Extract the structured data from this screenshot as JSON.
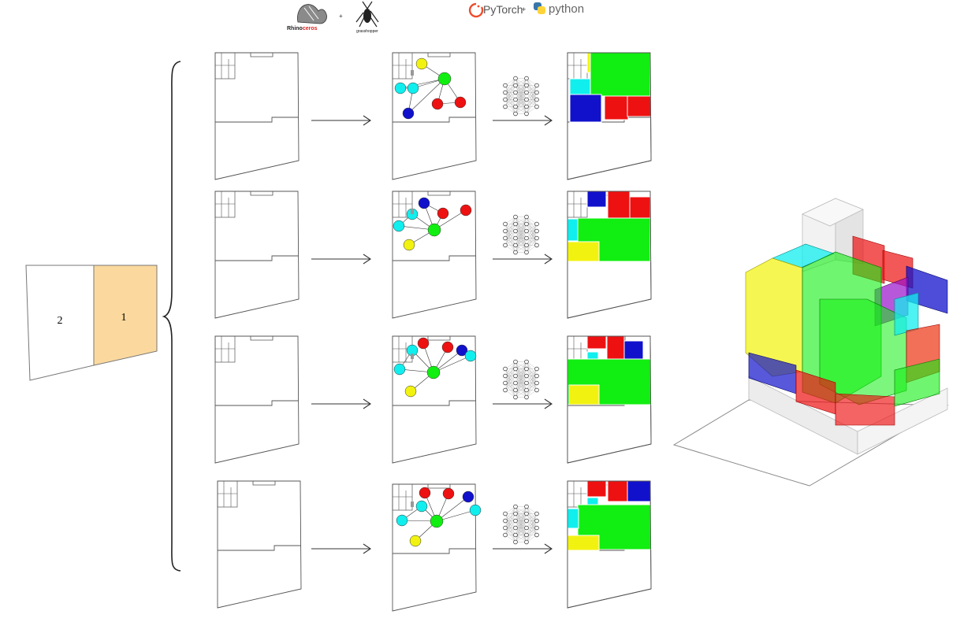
{
  "header": {
    "rhino_logo": {
      "icon": "rhino-icon",
      "prefix": "Rhino",
      "suffix": "ceros"
    },
    "plus_1": "+",
    "grasshopper_logo": {
      "icon": "grasshopper-icon",
      "label": "grasshopper"
    },
    "pytorch_logo": {
      "icon": "pytorch-icon",
      "label": "PyTorch"
    },
    "plus_2": "+",
    "python_logo": {
      "icon": "python-icon",
      "label": "python"
    }
  },
  "site_plan": {
    "plots": [
      {
        "label": "2",
        "color": "#ffffff"
      },
      {
        "label": "1",
        "color": "#fbd99e"
      }
    ]
  },
  "rows_count": 4,
  "colors": {
    "living": "#11ee11",
    "bedroom": "#ee1111",
    "bath": "#1111cc",
    "service": "#11eeee",
    "entry": "#f2f211",
    "stroke": "#555555",
    "lot_fill": "#fbd99e"
  },
  "icons": [
    "arrow-right-icon",
    "neural-network-icon",
    "brace-icon"
  ]
}
